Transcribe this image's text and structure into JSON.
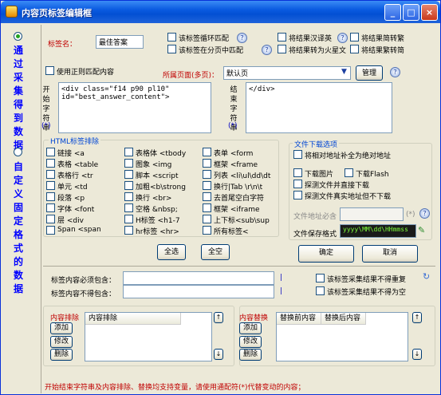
{
  "window": {
    "title": "内容页标签编辑框",
    "minimize": "_",
    "maximize": "□",
    "close": "×"
  },
  "left": {
    "option1": "通过采集得到数据",
    "option2": "自定义固定格式的数据"
  },
  "top": {
    "tag_name_label": "标签名：",
    "tag_name_value": "最佳答案",
    "loop_match": "该标签循环匹配",
    "page_match": "该标签在分页中匹配",
    "chinese_to_english": "将结果汉译英",
    "to_mars": "将结果转为火星文",
    "simp_to_trad": "将结果简转繁",
    "trad_to_simp": "将结果繁转简"
  },
  "regex": {
    "use_regex": "使用正则匹配内容",
    "page_label": "所属页面(多页)：",
    "page_value": "默认页",
    "manage": "管理"
  },
  "start": {
    "label": "开始字符串",
    "marker": "(*)",
    "value": "<div class=\"f14 p90 pl10\"\nid=\"best_answer_content\">"
  },
  "end": {
    "label": "结束字符串",
    "marker": "(*)",
    "value": "</div>"
  },
  "html": {
    "title": "HTML标签排除",
    "items": [
      "链接 <a",
      "表格体 <tbody",
      "表单 <form",
      "表格 <table",
      "图象 <img",
      "框架 <frame",
      "表格行 <tr",
      "脚本 <script",
      "列表 <li\\ul\\dd\\dt",
      "单元 <td",
      "加粗<b\\strong",
      "换行|Tab \\r\\n\\t",
      "段落 <p",
      "换行 <br>",
      "去首尾空白字符",
      "字体 <font",
      "空格 &nbsp;",
      "框架 <iframe",
      "层 <div",
      "H标签 <h1-7",
      "上下标<sub\\sup",
      "Span <span",
      "hr标签 <hr>",
      "所有标签<"
    ],
    "select_all": "全选",
    "clear_all": "全空"
  },
  "download": {
    "title": "文件下载选项",
    "absolute": "将相对地址补全为绝对地址",
    "download_image": "下载图片",
    "download_flash": "下载Flash",
    "detect_direct": "探测文件并直接下载",
    "detect_real": "探测文件真实地址但不下载",
    "address_required": "文件地址必含",
    "address_marker": "(*)",
    "save_format": "文件保存格式",
    "save_value": "yyyy\\MM\\dd\\HHmmss",
    "ok": "确定",
    "cancel": "取消"
  },
  "filters": {
    "must_contain": "标签内容必须包含：",
    "must_not_contain": "标签内容不得包含：",
    "must_contain_marker": "|",
    "must_not_contain_marker": "|",
    "no_duplicate": "该标签采集结果不得重复",
    "no_empty": "该标签采集结果不得为空"
  },
  "exclude": {
    "title": "内容排除",
    "add": "添加",
    "edit": "修改",
    "delete": "删除",
    "column": "内容排除"
  },
  "replace": {
    "title": "内容替换",
    "add": "添加",
    "edit": "修改",
    "delete": "删除",
    "col_before": "替换前内容",
    "col_after": "替换后内容"
  },
  "footer": "开始结束字符串及内容排除、替换均支持变量，请使用通配符(*)代替变动的内容；"
}
